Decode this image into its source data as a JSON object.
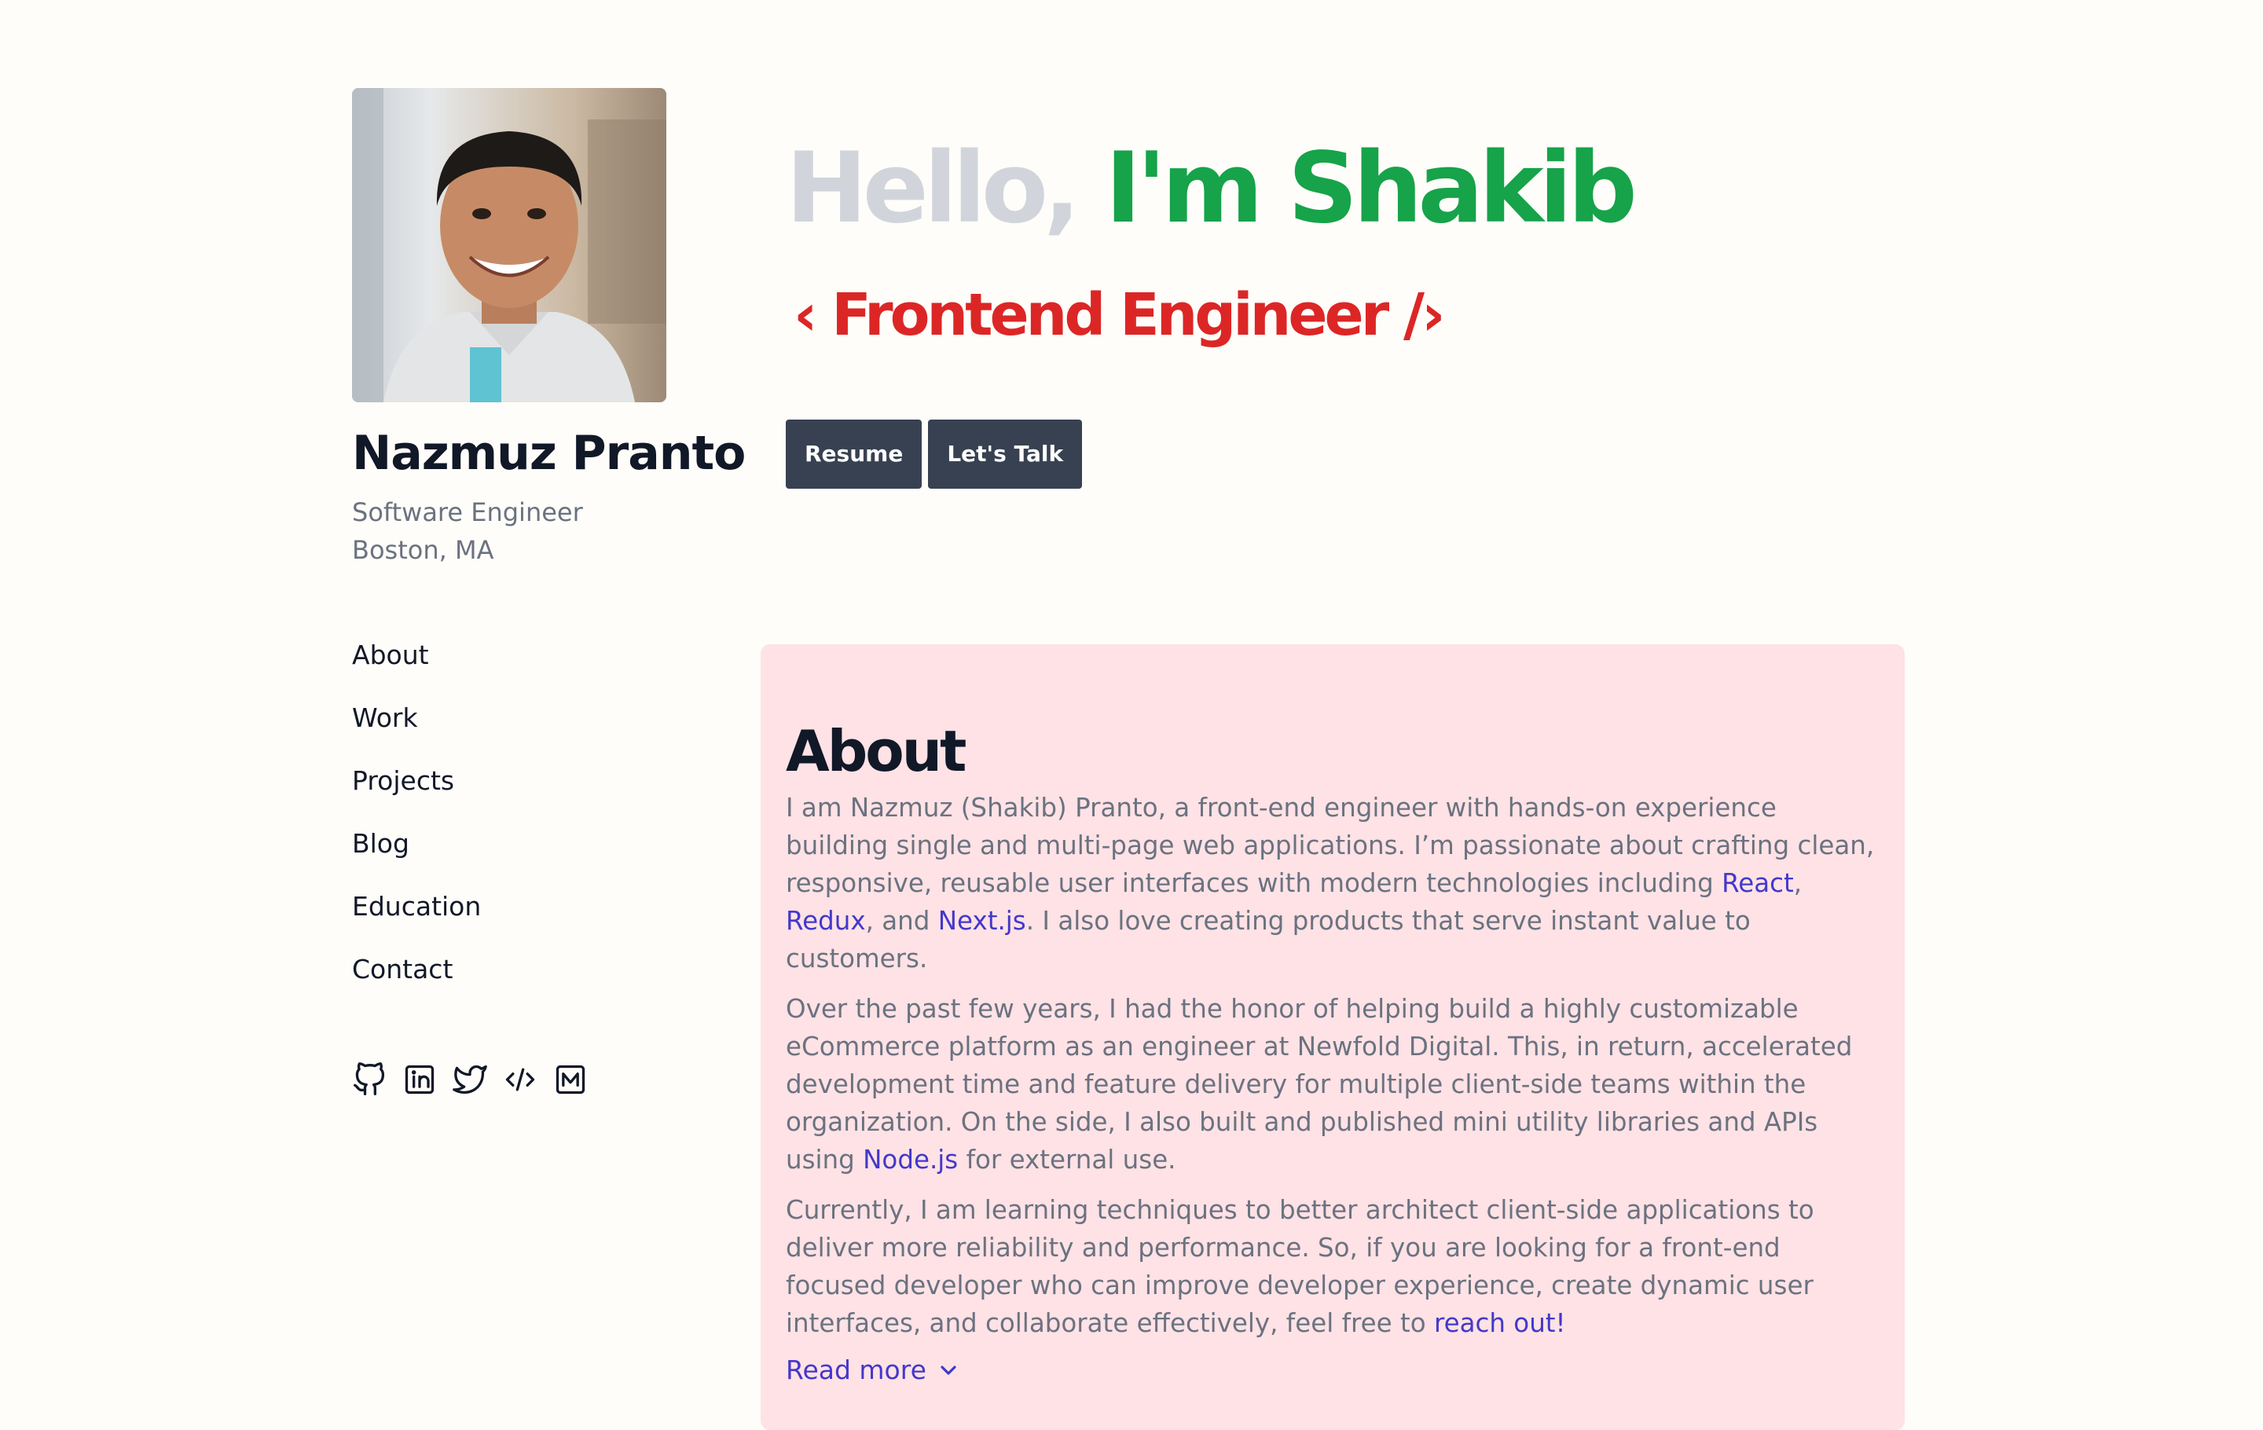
{
  "profile": {
    "name": "Nazmuz Pranto",
    "role": "Software Engineer",
    "location": "Boston, MA"
  },
  "nav": {
    "items": [
      {
        "label": "About"
      },
      {
        "label": "Work"
      },
      {
        "label": "Projects"
      },
      {
        "label": "Blog"
      },
      {
        "label": "Education"
      },
      {
        "label": "Contact"
      }
    ]
  },
  "socials": [
    "github-icon",
    "linkedin-icon",
    "twitter-icon",
    "code-icon",
    "medium-icon"
  ],
  "hero": {
    "hello": "Hello,",
    "im": "I'm Shakib",
    "subtitle": "‹ Frontend Engineer /›",
    "buttons": {
      "resume": "Resume",
      "talk": "Let's Talk"
    }
  },
  "about": {
    "title": "About",
    "p1": {
      "a": "I am Nazmuz (Shakib) Pranto, a front-end engineer with hands-on experience building single and multi-page web applications. I’m passionate about crafting clean, responsive, reusable user interfaces with modern technologies including ",
      "react": "React",
      "comma1": ", ",
      "redux": "Redux",
      "b": ", and ",
      "next": "Next.js",
      "c": ". I also love creating products that serve instant value to customers."
    },
    "p2": {
      "a": "Over the past few years, I had the honor of helping build a highly customizable eCommerce platform as an engineer at Newfold Digital. This, in return, accelerated development time and feature delivery for multiple client-side teams within the organization. On the side, I also built and published mini utility libraries and APIs using ",
      "node": "Node.js",
      "b": " for external use."
    },
    "p3": {
      "a": "Currently, I am learning techniques to better architect client-side applications to deliver more reliability and performance. So, if you are looking for a front-end focused developer who can improve developer experience, create dynamic user interfaces, and collaborate effectively, feel free to ",
      "reach": "reach out!"
    },
    "read_more": "Read more"
  },
  "colors": {
    "background": "#fefdf9",
    "green": "#16a34a",
    "red": "#dc2626",
    "card": "#fee2e5",
    "link": "#4338ca",
    "button": "#374151"
  }
}
